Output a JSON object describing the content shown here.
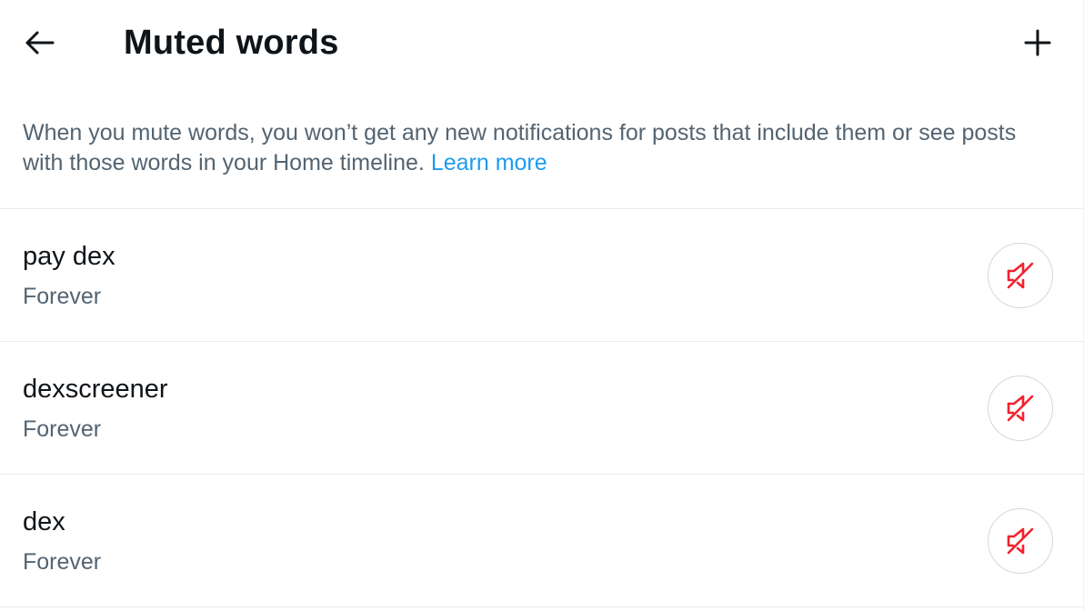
{
  "header": {
    "title": "Muted words",
    "back_icon": "arrow-left-icon",
    "add_icon": "plus-icon"
  },
  "description": {
    "text": "When you mute words, you won’t get any new notifications for posts that include them or see posts with those words in your Home timeline.",
    "link_text": "Learn more"
  },
  "muted_words": [
    {
      "word": "pay dex",
      "duration": "Forever",
      "icon": "unmute-speaker-icon"
    },
    {
      "word": "dexscreener",
      "duration": "Forever",
      "icon": "unmute-speaker-icon"
    },
    {
      "word": "dex",
      "duration": "Forever",
      "icon": "unmute-speaker-icon"
    }
  ],
  "colors": {
    "text_primary": "#0f1419",
    "text_secondary": "#536471",
    "link": "#1d9bf0",
    "unmute_icon": "#f4212e",
    "border": "#cfd9de"
  }
}
